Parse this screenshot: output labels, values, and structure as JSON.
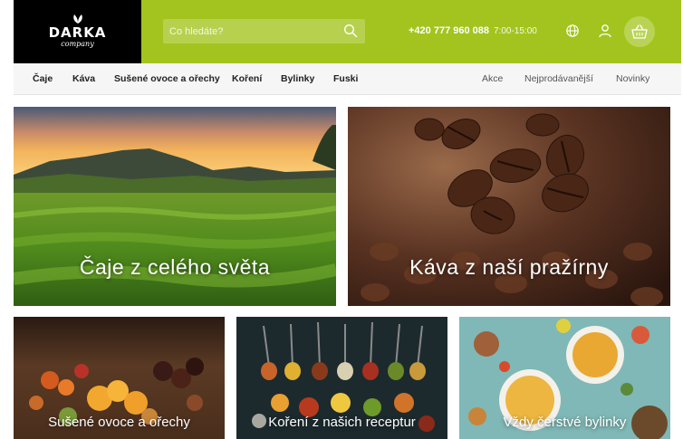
{
  "brand": {
    "name": "DARKA",
    "tagline": "company"
  },
  "search": {
    "placeholder": "Co hledáte?"
  },
  "contact": {
    "phone": "+420 777 960 088",
    "hours": "7:00-15:00"
  },
  "icons": {
    "search": "search-icon",
    "language": "globe-icon",
    "account": "user-icon",
    "cart": "basket-icon",
    "logo": "tea-leaf-icon"
  },
  "colors": {
    "accent": "#a3c41e",
    "logo_bg": "#000000",
    "nav_bg": "#f6f6f6"
  },
  "nav": {
    "main": [
      {
        "label": "Čaje"
      },
      {
        "label": "Káva"
      },
      {
        "label": "Sušené ovoce a ořechy"
      },
      {
        "label": "Koření"
      },
      {
        "label": "Bylinky"
      },
      {
        "label": "Fuski"
      }
    ],
    "secondary": [
      {
        "label": "Akce"
      },
      {
        "label": "Nejprodávanější"
      },
      {
        "label": "Novinky"
      }
    ]
  },
  "categories": [
    {
      "title": "Čaje z celého světa"
    },
    {
      "title": "Káva z naší pražírny"
    },
    {
      "title": "Sušené ovoce a ořechy"
    },
    {
      "title": "Koření z našich receptur"
    },
    {
      "title": "Vždy čerstvé bylinky"
    }
  ]
}
